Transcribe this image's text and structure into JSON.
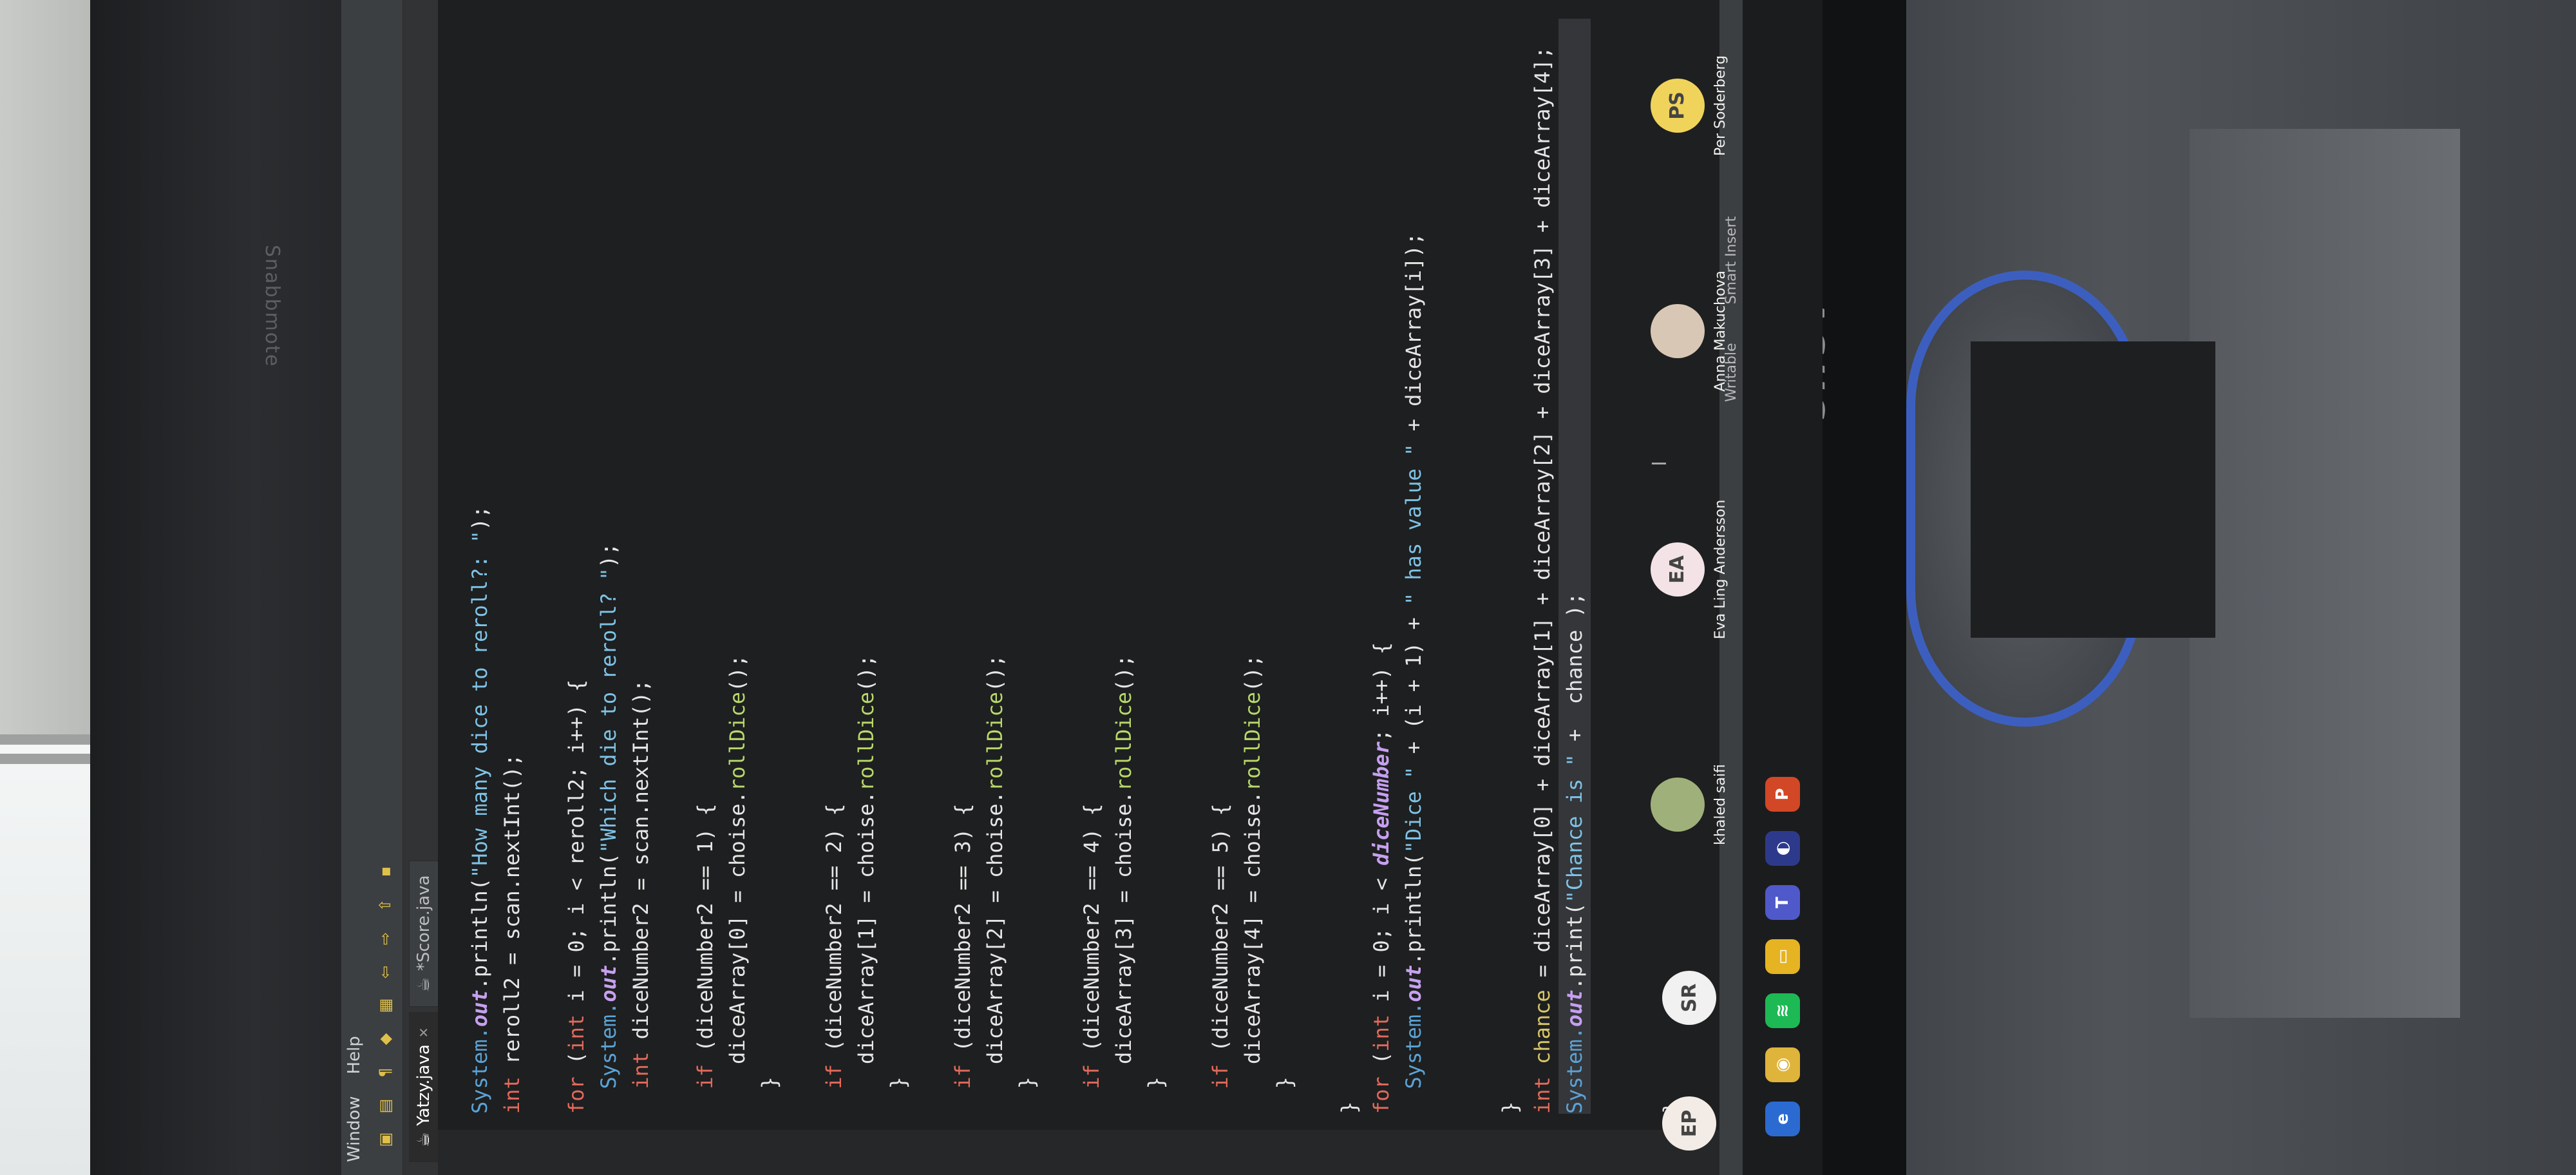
{
  "monitor": {
    "top_brand": "Snabbmote",
    "bottom_brand": "ASUS"
  },
  "ide": {
    "menu": [
      "Window",
      "Help"
    ],
    "tabs": [
      {
        "label": "Yatzy.java",
        "active": true
      },
      {
        "label": "*Score.java",
        "active": false
      }
    ],
    "status": {
      "mode": "Writable",
      "insert": "Smart Insert"
    },
    "code_lines": [
      [
        {
          "t": "System.",
          "c": "sys"
        },
        {
          "t": "out",
          "c": "fd"
        },
        {
          "t": ".println(",
          "c": "pl"
        },
        {
          "t": "\"How many dice to reroll?: \"",
          "c": "st"
        },
        {
          "t": ");",
          "c": "pl"
        }
      ],
      [
        {
          "t": "int ",
          "c": "tp"
        },
        {
          "t": "reroll2 = scan.nextInt();",
          "c": "pl"
        }
      ],
      [
        {
          "t": "",
          "c": "pl"
        }
      ],
      [
        {
          "t": "for ",
          "c": "kw"
        },
        {
          "t": "(",
          "c": "pl"
        },
        {
          "t": "int ",
          "c": "tp"
        },
        {
          "t": "i = 0; i < reroll2; i++) {",
          "c": "pl"
        }
      ],
      [
        {
          "t": "  System.",
          "c": "sys"
        },
        {
          "t": "out",
          "c": "fd"
        },
        {
          "t": ".println(",
          "c": "pl"
        },
        {
          "t": "\"Which die to reroll? \"",
          "c": "st"
        },
        {
          "t": ");",
          "c": "pl"
        }
      ],
      [
        {
          "t": "  int ",
          "c": "tp"
        },
        {
          "t": "diceNumber2 = scan.nextInt();",
          "c": "pl"
        }
      ],
      [
        {
          "t": "",
          "c": "pl"
        }
      ],
      [
        {
          "t": "  if ",
          "c": "kw"
        },
        {
          "t": "(diceNumber2 == 1) {",
          "c": "pl"
        }
      ],
      [
        {
          "t": "    diceArray[0] = choise.",
          "c": "pl"
        },
        {
          "t": "rollDice",
          "c": "mt"
        },
        {
          "t": "();",
          "c": "pl"
        }
      ],
      [
        {
          "t": "  }",
          "c": "pl"
        }
      ],
      [
        {
          "t": "",
          "c": "pl"
        }
      ],
      [
        {
          "t": "  if ",
          "c": "kw"
        },
        {
          "t": "(diceNumber2 == 2) {",
          "c": "pl"
        }
      ],
      [
        {
          "t": "    diceArray[1] = choise.",
          "c": "pl"
        },
        {
          "t": "rollDice",
          "c": "mt"
        },
        {
          "t": "();",
          "c": "pl"
        }
      ],
      [
        {
          "t": "  }",
          "c": "pl"
        }
      ],
      [
        {
          "t": "",
          "c": "pl"
        }
      ],
      [
        {
          "t": "  if ",
          "c": "kw"
        },
        {
          "t": "(diceNumber2 == 3) {",
          "c": "pl"
        }
      ],
      [
        {
          "t": "    diceArray[2] = choise.",
          "c": "pl"
        },
        {
          "t": "rollDice",
          "c": "mt"
        },
        {
          "t": "();",
          "c": "pl"
        }
      ],
      [
        {
          "t": "  }",
          "c": "pl"
        }
      ],
      [
        {
          "t": "",
          "c": "pl"
        }
      ],
      [
        {
          "t": "  if ",
          "c": "kw"
        },
        {
          "t": "(diceNumber2 == 4) {",
          "c": "pl"
        }
      ],
      [
        {
          "t": "    diceArray[3] = choise.",
          "c": "pl"
        },
        {
          "t": "rollDice",
          "c": "mt"
        },
        {
          "t": "();",
          "c": "pl"
        }
      ],
      [
        {
          "t": "  }",
          "c": "pl"
        }
      ],
      [
        {
          "t": "",
          "c": "pl"
        }
      ],
      [
        {
          "t": "  if ",
          "c": "kw"
        },
        {
          "t": "(diceNumber2 == 5) {",
          "c": "pl"
        }
      ],
      [
        {
          "t": "    diceArray[4] = choise.",
          "c": "pl"
        },
        {
          "t": "rollDice",
          "c": "mt"
        },
        {
          "t": "();",
          "c": "pl"
        }
      ],
      [
        {
          "t": "  }",
          "c": "pl"
        }
      ],
      [
        {
          "t": "",
          "c": "pl"
        }
      ],
      [
        {
          "t": "}",
          "c": "pl"
        }
      ],
      [
        {
          "t": "for ",
          "c": "kw"
        },
        {
          "t": "(",
          "c": "pl"
        },
        {
          "t": "int ",
          "c": "tp"
        },
        {
          "t": "i = 0; i < ",
          "c": "pl"
        },
        {
          "t": "diceNumber",
          "c": "fd"
        },
        {
          "t": "; i++) {",
          "c": "pl"
        }
      ],
      [
        {
          "t": "  System.",
          "c": "sys"
        },
        {
          "t": "out",
          "c": "fd"
        },
        {
          "t": ".println(",
          "c": "pl"
        },
        {
          "t": "\"Dice \"",
          "c": "st"
        },
        {
          "t": " + (i + 1) + ",
          "c": "pl"
        },
        {
          "t": "\" has value \"",
          "c": "st"
        },
        {
          "t": " + diceArray[i]);",
          "c": "pl"
        }
      ],
      [
        {
          "t": "",
          "c": "pl"
        }
      ],
      [
        {
          "t": "",
          "c": "pl"
        }
      ],
      [
        {
          "t": "}",
          "c": "pl"
        }
      ],
      [
        {
          "t": "int ",
          "c": "tp"
        },
        {
          "t": "chance",
          "c": "vr"
        },
        {
          "t": " = diceArray[0] + diceArray[1] + diceArray[2] + diceArray[3] + diceArray[4];",
          "c": "pl"
        }
      ],
      [
        {
          "t": "System.",
          "c": "sys"
        },
        {
          "t": "out",
          "c": "fd"
        },
        {
          "t": ".print(",
          "c": "pl"
        },
        {
          "t": "\"Chance is \"",
          "c": "st"
        },
        {
          "t": " +  chance );",
          "c": "pl"
        }
      ],
      [
        {
          "t": "",
          "c": "pl"
        }
      ],
      [
        {
          "t": "",
          "c": "pl"
        }
      ],
      [
        {
          "t": "}",
          "c": "pl"
        }
      ],
      [
        {
          "t": "",
          "c": "pl"
        }
      ],
      [
        {
          "t": "}",
          "c": "pl"
        }
      ],
      [
        {
          "t": "",
          "c": "pl"
        }
      ],
      [
        {
          "t": "}",
          "c": "pl"
        }
      ]
    ]
  },
  "meeting": {
    "participants": [
      {
        "initials": "EP",
        "name": "",
        "bg": "#f3ece6"
      },
      {
        "initials": "SR",
        "name": "",
        "bg": "#f1f1f1"
      },
      {
        "initials": "",
        "name": "khaled saifi",
        "bg": "#9fb07a"
      },
      {
        "initials": "EA",
        "name": "Eva Ling Andersson",
        "bg": "#f3e3e6"
      },
      {
        "initials": "",
        "name": "Anna Makuchova",
        "bg": "#d9c7b5"
      },
      {
        "initials": "PS",
        "name": "Per Soderberg",
        "bg": "#f0d35a"
      }
    ]
  },
  "colors": {
    "keyword": "#e26a5c",
    "string": "#7ec3e6",
    "field": "#c6a0f0",
    "method": "#b8d96a"
  }
}
